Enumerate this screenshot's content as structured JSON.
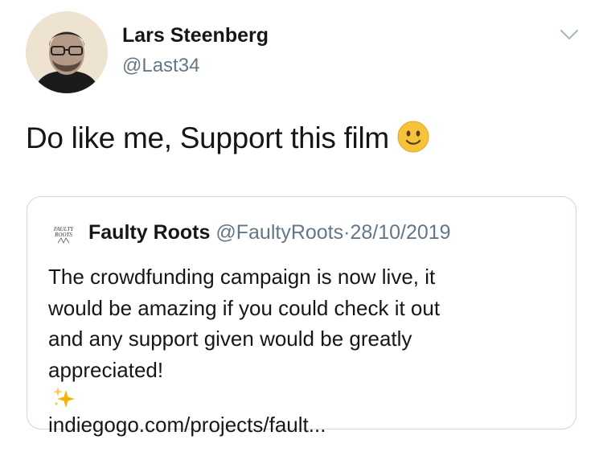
{
  "author": {
    "name": "Lars Steenberg",
    "handle": "@Last34"
  },
  "tweet": {
    "text": "Do like me, Support this film",
    "emoji": "slightly-smiling-face-icon"
  },
  "quoted_tweet": {
    "author_name": "Faulty Roots",
    "author_handle": "@FaultyRoots",
    "separator": "·",
    "date": "28/10/2019",
    "logo_text": "FAULTY ROOTS",
    "body_lines": [
      "The crowdfunding campaign is now live, it",
      "would be amazing if you could check it out",
      "and any support given would be greatly",
      "appreciated!"
    ],
    "emoji": "sparkles-icon",
    "link": "indiegogo.com/projects/fault..."
  },
  "colors": {
    "text": "#14171a",
    "secondary": "#657786",
    "border": "#ccd6dd",
    "emoji_yellow": "#f7c33b",
    "sparkle_gold": "#f4b400"
  }
}
